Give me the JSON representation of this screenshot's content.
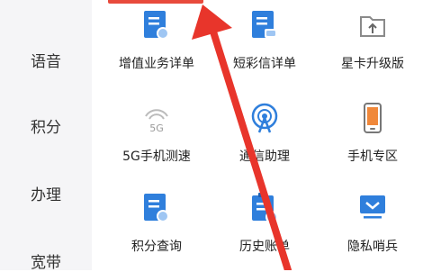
{
  "sidebar": {
    "items": [
      {
        "label": "语音"
      },
      {
        "label": "积分"
      },
      {
        "label": "办理"
      },
      {
        "label": "宽带"
      }
    ]
  },
  "grid": {
    "items": [
      {
        "label": "增值业务详单",
        "icon": "doc-search-icon"
      },
      {
        "label": "短彩信详单",
        "icon": "doc-message-icon"
      },
      {
        "label": "星卡升级版",
        "icon": "folder-upload-icon"
      },
      {
        "label": "5G手机测速",
        "icon": "5g-signal-icon"
      },
      {
        "label": "通信助理",
        "icon": "assistant-antenna-icon"
      },
      {
        "label": "手机专区",
        "icon": "phone-icon"
      },
      {
        "label": "积分查询",
        "icon": "points-doc-icon"
      },
      {
        "label": "历史账单",
        "icon": "history-bill-icon"
      },
      {
        "label": "隐私哨兵",
        "icon": "privacy-monitor-icon"
      }
    ]
  },
  "colors": {
    "accent_blue": "#2f7fdc",
    "arrow_red": "#e8352b",
    "sidebar_bg": "#f5f5f7"
  }
}
